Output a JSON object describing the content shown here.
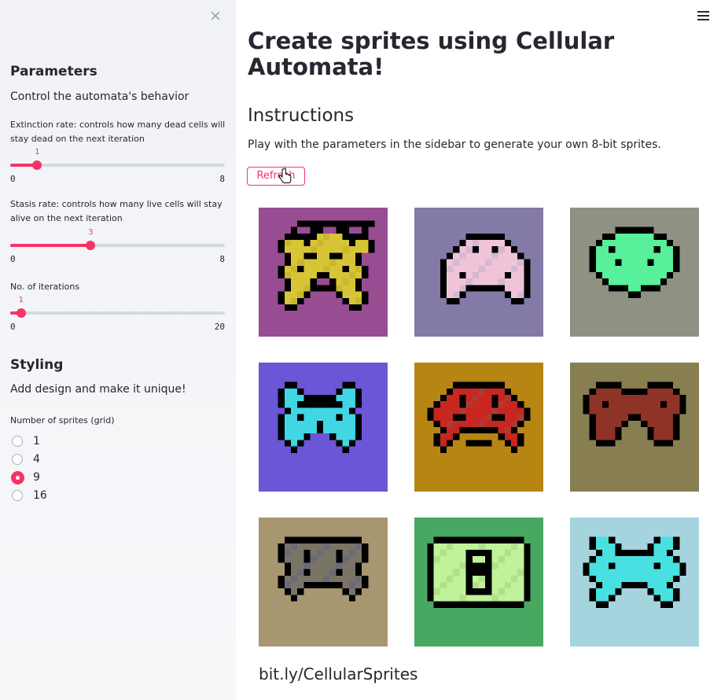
{
  "sidebar": {
    "close_label": "×",
    "parameters": {
      "heading": "Parameters",
      "subtitle": "Control the automata's behavior",
      "extinction": {
        "label": "Extinction rate: controls how many dead cells will stay dead on the next iteration",
        "value": "1",
        "min": "0",
        "max": "8",
        "fraction": 0.125
      },
      "stasis": {
        "label": "Stasis rate: controls how many live cells will stay alive on the next iteration",
        "value": "3",
        "min": "0",
        "max": "8",
        "fraction": 0.375
      },
      "iterations": {
        "label": "No. of iterations",
        "value": "1",
        "min": "0",
        "max": "20",
        "fraction": 0.05
      }
    },
    "styling": {
      "heading": "Styling",
      "subtitle": "Add design and make it unique!",
      "grid_label": "Number of sprites (grid)",
      "options": [
        "1",
        "4",
        "9",
        "16"
      ],
      "selected": "9"
    }
  },
  "main": {
    "title": "Create sprites using Cellular Automata!",
    "instructions_heading": "Instructions",
    "instructions_text": "Play with the parameters in the sidebar to generate your own 8-bit sprites.",
    "refresh_label": "Refresh",
    "footer_link": "bit.ly/CellularSprites"
  },
  "sprites": [
    {
      "bg": "#984c91",
      "fg": "#d8c536",
      "alt": "#c9b82f",
      "pattern": "A"
    },
    {
      "bg": "#847aa7",
      "fg": "#f0c4d8",
      "alt": "#d6b8cf",
      "pattern": "B"
    },
    {
      "bg": "#8f9183",
      "fg": "#58f09a",
      "alt": "#58f09a",
      "pattern": "C"
    },
    {
      "bg": "#6a56d6",
      "fg": "#40d6e4",
      "alt": "#40d6e4",
      "pattern": "D"
    },
    {
      "bg": "#b78512",
      "fg": "#c82620",
      "alt": "#b03a30",
      "pattern": "E"
    },
    {
      "bg": "#877f4f",
      "fg": "#8e3326",
      "alt": "#8e3326",
      "pattern": "F"
    },
    {
      "bg": "#a79670",
      "fg": "#7a7466",
      "alt": "#6a6a78",
      "pattern": "G"
    },
    {
      "bg": "#48a862",
      "fg": "#c0f29a",
      "alt": "#b0e08a",
      "pattern": "H"
    },
    {
      "bg": "#a5d4df",
      "fg": "#48e0e0",
      "alt": "#48e0e0",
      "pattern": "I"
    }
  ],
  "colors": {
    "accent": "#f63366",
    "track": "#d5d8de",
    "text": "#262730"
  }
}
